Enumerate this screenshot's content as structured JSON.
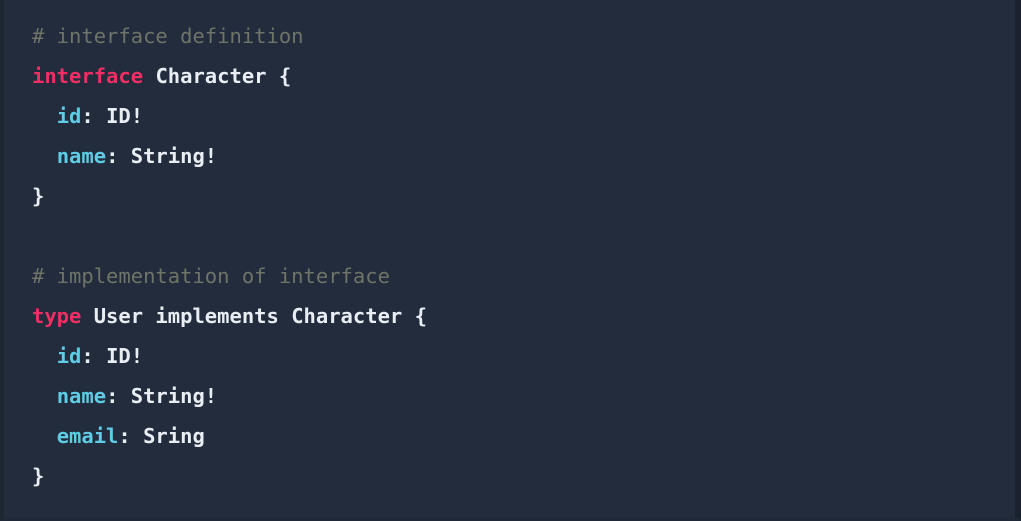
{
  "editor": {
    "language": "graphql",
    "background_color": "#222c3c",
    "default_text_color": "#e8edf3",
    "token_colors": {
      "comment": "#6f7468",
      "keyword": "#ed2f63",
      "field": "#5fcce6",
      "type": "#e9eef4",
      "punctuation": "#e9eef4"
    }
  },
  "code": {
    "lines": [
      {
        "index": 0,
        "text": "# interface definition",
        "tokens": [
          {
            "text": "# interface definition",
            "kind": "comment"
          }
        ]
      },
      {
        "index": 1,
        "text": "interface Character {",
        "tokens": [
          {
            "text": "interface",
            "kind": "keyword"
          },
          {
            "text": " ",
            "kind": "plain"
          },
          {
            "text": "Character",
            "kind": "type"
          },
          {
            "text": " ",
            "kind": "plain"
          },
          {
            "text": "{",
            "kind": "punct"
          }
        ]
      },
      {
        "index": 2,
        "text": "  id: ID!",
        "tokens": [
          {
            "text": "  ",
            "kind": "plain"
          },
          {
            "text": "id",
            "kind": "field"
          },
          {
            "text": ": ",
            "kind": "punct"
          },
          {
            "text": "ID!",
            "kind": "type"
          }
        ]
      },
      {
        "index": 3,
        "text": "  name: String!",
        "tokens": [
          {
            "text": "  ",
            "kind": "plain"
          },
          {
            "text": "name",
            "kind": "field"
          },
          {
            "text": ": ",
            "kind": "punct"
          },
          {
            "text": "String!",
            "kind": "type"
          }
        ]
      },
      {
        "index": 4,
        "text": "}",
        "tokens": [
          {
            "text": "}",
            "kind": "punct"
          }
        ]
      },
      {
        "index": 5,
        "text": "",
        "tokens": [
          {
            "text": " ",
            "kind": "blank"
          }
        ]
      },
      {
        "index": 6,
        "text": "# implementation of interface",
        "tokens": [
          {
            "text": "# implementation of interface",
            "kind": "comment"
          }
        ]
      },
      {
        "index": 7,
        "text": "type User implements Character {",
        "tokens": [
          {
            "text": "type",
            "kind": "keyword"
          },
          {
            "text": " ",
            "kind": "plain"
          },
          {
            "text": "User implements Character",
            "kind": "type"
          },
          {
            "text": " ",
            "kind": "plain"
          },
          {
            "text": "{",
            "kind": "punct"
          }
        ]
      },
      {
        "index": 8,
        "text": "  id: ID!",
        "tokens": [
          {
            "text": "  ",
            "kind": "plain"
          },
          {
            "text": "id",
            "kind": "field"
          },
          {
            "text": ": ",
            "kind": "punct"
          },
          {
            "text": "ID!",
            "kind": "type"
          }
        ]
      },
      {
        "index": 9,
        "text": "  name: String!",
        "tokens": [
          {
            "text": "  ",
            "kind": "plain"
          },
          {
            "text": "name",
            "kind": "field"
          },
          {
            "text": ": ",
            "kind": "punct"
          },
          {
            "text": "String!",
            "kind": "type"
          }
        ]
      },
      {
        "index": 10,
        "text": "  email: Sring",
        "tokens": [
          {
            "text": "  ",
            "kind": "plain"
          },
          {
            "text": "email",
            "kind": "field"
          },
          {
            "text": ": ",
            "kind": "punct"
          },
          {
            "text": "Sring",
            "kind": "type"
          }
        ]
      },
      {
        "index": 11,
        "text": "}",
        "tokens": [
          {
            "text": "}",
            "kind": "punct"
          }
        ]
      }
    ]
  }
}
